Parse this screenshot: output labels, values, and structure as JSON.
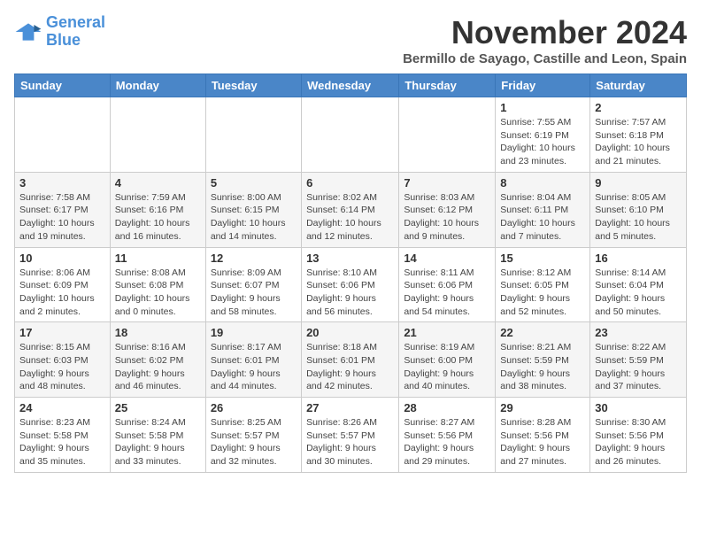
{
  "logo": {
    "line1": "General",
    "line2": "Blue"
  },
  "title": "November 2024",
  "subtitle": "Bermillo de Sayago, Castille and Leon, Spain",
  "days_header": [
    "Sunday",
    "Monday",
    "Tuesday",
    "Wednesday",
    "Thursday",
    "Friday",
    "Saturday"
  ],
  "weeks": [
    [
      {
        "day": "",
        "info": ""
      },
      {
        "day": "",
        "info": ""
      },
      {
        "day": "",
        "info": ""
      },
      {
        "day": "",
        "info": ""
      },
      {
        "day": "",
        "info": ""
      },
      {
        "day": "1",
        "info": "Sunrise: 7:55 AM\nSunset: 6:19 PM\nDaylight: 10 hours\nand 23 minutes."
      },
      {
        "day": "2",
        "info": "Sunrise: 7:57 AM\nSunset: 6:18 PM\nDaylight: 10 hours\nand 21 minutes."
      }
    ],
    [
      {
        "day": "3",
        "info": "Sunrise: 7:58 AM\nSunset: 6:17 PM\nDaylight: 10 hours\nand 19 minutes."
      },
      {
        "day": "4",
        "info": "Sunrise: 7:59 AM\nSunset: 6:16 PM\nDaylight: 10 hours\nand 16 minutes."
      },
      {
        "day": "5",
        "info": "Sunrise: 8:00 AM\nSunset: 6:15 PM\nDaylight: 10 hours\nand 14 minutes."
      },
      {
        "day": "6",
        "info": "Sunrise: 8:02 AM\nSunset: 6:14 PM\nDaylight: 10 hours\nand 12 minutes."
      },
      {
        "day": "7",
        "info": "Sunrise: 8:03 AM\nSunset: 6:12 PM\nDaylight: 10 hours\nand 9 minutes."
      },
      {
        "day": "8",
        "info": "Sunrise: 8:04 AM\nSunset: 6:11 PM\nDaylight: 10 hours\nand 7 minutes."
      },
      {
        "day": "9",
        "info": "Sunrise: 8:05 AM\nSunset: 6:10 PM\nDaylight: 10 hours\nand 5 minutes."
      }
    ],
    [
      {
        "day": "10",
        "info": "Sunrise: 8:06 AM\nSunset: 6:09 PM\nDaylight: 10 hours\nand 2 minutes."
      },
      {
        "day": "11",
        "info": "Sunrise: 8:08 AM\nSunset: 6:08 PM\nDaylight: 10 hours\nand 0 minutes."
      },
      {
        "day": "12",
        "info": "Sunrise: 8:09 AM\nSunset: 6:07 PM\nDaylight: 9 hours\nand 58 minutes."
      },
      {
        "day": "13",
        "info": "Sunrise: 8:10 AM\nSunset: 6:06 PM\nDaylight: 9 hours\nand 56 minutes."
      },
      {
        "day": "14",
        "info": "Sunrise: 8:11 AM\nSunset: 6:06 PM\nDaylight: 9 hours\nand 54 minutes."
      },
      {
        "day": "15",
        "info": "Sunrise: 8:12 AM\nSunset: 6:05 PM\nDaylight: 9 hours\nand 52 minutes."
      },
      {
        "day": "16",
        "info": "Sunrise: 8:14 AM\nSunset: 6:04 PM\nDaylight: 9 hours\nand 50 minutes."
      }
    ],
    [
      {
        "day": "17",
        "info": "Sunrise: 8:15 AM\nSunset: 6:03 PM\nDaylight: 9 hours\nand 48 minutes."
      },
      {
        "day": "18",
        "info": "Sunrise: 8:16 AM\nSunset: 6:02 PM\nDaylight: 9 hours\nand 46 minutes."
      },
      {
        "day": "19",
        "info": "Sunrise: 8:17 AM\nSunset: 6:01 PM\nDaylight: 9 hours\nand 44 minutes."
      },
      {
        "day": "20",
        "info": "Sunrise: 8:18 AM\nSunset: 6:01 PM\nDaylight: 9 hours\nand 42 minutes."
      },
      {
        "day": "21",
        "info": "Sunrise: 8:19 AM\nSunset: 6:00 PM\nDaylight: 9 hours\nand 40 minutes."
      },
      {
        "day": "22",
        "info": "Sunrise: 8:21 AM\nSunset: 5:59 PM\nDaylight: 9 hours\nand 38 minutes."
      },
      {
        "day": "23",
        "info": "Sunrise: 8:22 AM\nSunset: 5:59 PM\nDaylight: 9 hours\nand 37 minutes."
      }
    ],
    [
      {
        "day": "24",
        "info": "Sunrise: 8:23 AM\nSunset: 5:58 PM\nDaylight: 9 hours\nand 35 minutes."
      },
      {
        "day": "25",
        "info": "Sunrise: 8:24 AM\nSunset: 5:58 PM\nDaylight: 9 hours\nand 33 minutes."
      },
      {
        "day": "26",
        "info": "Sunrise: 8:25 AM\nSunset: 5:57 PM\nDaylight: 9 hours\nand 32 minutes."
      },
      {
        "day": "27",
        "info": "Sunrise: 8:26 AM\nSunset: 5:57 PM\nDaylight: 9 hours\nand 30 minutes."
      },
      {
        "day": "28",
        "info": "Sunrise: 8:27 AM\nSunset: 5:56 PM\nDaylight: 9 hours\nand 29 minutes."
      },
      {
        "day": "29",
        "info": "Sunrise: 8:28 AM\nSunset: 5:56 PM\nDaylight: 9 hours\nand 27 minutes."
      },
      {
        "day": "30",
        "info": "Sunrise: 8:30 AM\nSunset: 5:56 PM\nDaylight: 9 hours\nand 26 minutes."
      }
    ]
  ]
}
